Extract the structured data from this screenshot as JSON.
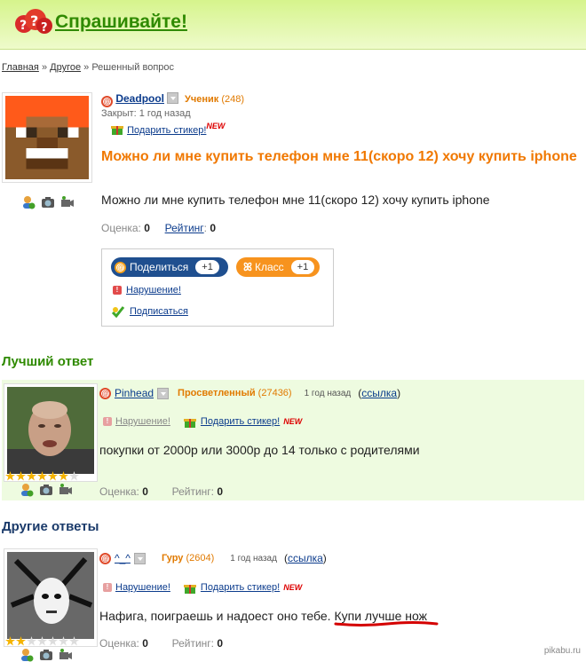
{
  "header": {
    "title": "Спрашивайте!"
  },
  "breadcrumb": {
    "home": "Главная",
    "sep1": "»",
    "category": "Другое",
    "sep2": "»",
    "current": "Решенный вопрос"
  },
  "question": {
    "author": "Deadpool",
    "rank": "Ученик",
    "points": "(248)",
    "closed": "Закрыт: 1 год назад",
    "gift_label": "Подарить стикер!",
    "new_badge": "NEW",
    "title": "Можно ли мне купить телефон мне 11(скоро 12) хочу купить iphone",
    "body": "Можно ли мне купить телефон мне 11(скоро 12) хочу купить iphone",
    "rating_label": "Оценка:",
    "rating_value": "0",
    "score_label": "Рейтинг",
    "score_value": "0",
    "share_label": "Поделиться",
    "share_count": "+1",
    "class_label": "Класс",
    "class_count": "+1",
    "report_label": "Нарушение!",
    "subscribe_label": "Подписаться"
  },
  "best": {
    "heading": "Лучший ответ",
    "author": "Pinhead",
    "rank": "Просветленный",
    "points": "(27436)",
    "time": "1 год назад",
    "link": "ссылка",
    "report_label": "Нарушение!",
    "gift_label": "Подарить стикер!",
    "new_badge": "NEW",
    "text": "покупки от 2000р или 3000р до 14 только с родителями",
    "rating_label": "Оценка:",
    "rating_value": "0",
    "score_label": "Рейтинг:",
    "score_value": "0",
    "stars_filled": 6,
    "stars_total": 7
  },
  "others": {
    "heading": "Другие ответы",
    "author": "^_^",
    "rank": "Гуру",
    "points": "(2604)",
    "time": "1 год назад",
    "link": "ссылка",
    "report_label": "Нарушение!",
    "gift_label": "Подарить стикер!",
    "new_badge": "NEW",
    "text_a": "Нафига, поиграешь и надоест оно тебе.",
    "text_b": "Купи лучше нож",
    "rating_label": "Оценка:",
    "rating_value": "0",
    "score_label": "Рейтинг:",
    "score_value": "0",
    "stars_filled": 2,
    "stars_total": 7
  },
  "watermark": "pikabu.ru",
  "colors": {
    "orange": "#f07800",
    "green": "#2f8a00",
    "link": "#0b3b8c",
    "underline_red": "#d40000"
  }
}
